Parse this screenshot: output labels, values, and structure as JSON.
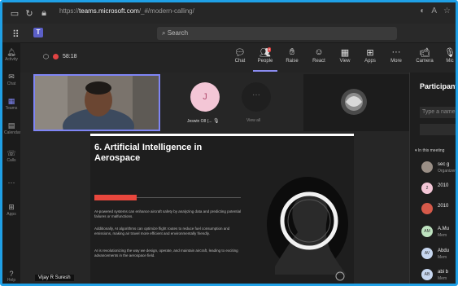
{
  "browser": {
    "url_prefix": "https://",
    "url_host": "teams.microsoft.com",
    "url_path": "/_#/modern-calling/"
  },
  "teams": {
    "search_placeholder": "Search"
  },
  "rail": [
    {
      "label": "Activity",
      "icon": "bell-icon"
    },
    {
      "label": "Chat",
      "icon": "chat-icon"
    },
    {
      "label": "Teams",
      "icon": "teams-icon"
    },
    {
      "label": "Calendar",
      "icon": "calendar-icon"
    },
    {
      "label": "Calls",
      "icon": "phone-icon"
    },
    {
      "label": "",
      "icon": "more-icon"
    },
    {
      "label": "Apps",
      "icon": "apps-icon"
    },
    {
      "label": "Help",
      "icon": "help-icon"
    }
  ],
  "meeting": {
    "timer": "58:18",
    "tools": [
      {
        "label": "Chat",
        "icon": "chat-icon"
      },
      {
        "label": "People",
        "icon": "people-icon"
      },
      {
        "label": "Raise",
        "icon": "hand-icon"
      },
      {
        "label": "React",
        "icon": "smile-icon"
      },
      {
        "label": "View",
        "icon": "grid-icon"
      },
      {
        "label": "Apps",
        "icon": "plus-box-icon"
      },
      {
        "label": "More",
        "icon": "more-icon"
      },
      {
        "label": "Camera",
        "icon": "camera-icon"
      },
      {
        "label": "Mic",
        "icon": "mic-icon"
      }
    ],
    "people_badge": "9"
  },
  "stage": {
    "jp_initial": "J",
    "jp_name": "Jeswin O8 (...",
    "view_all": "View all",
    "presenter": "Vijay R Suresh"
  },
  "slide": {
    "title": "6. Artificial Intelligence in Aerospace",
    "para1": "AI-powered systems can enhance aircraft safety by analyzing data and predicting potential failures or malfunctions.",
    "para2": "Additionally, AI algorithms can optimize flight routes to reduce fuel consumption and emissions, making air travel more efficient and environmentally friendly.",
    "para3": "AI is revolutionizing the way we design, operate, and maintain aircraft, leading to exciting advancements in the aerospace field."
  },
  "panel": {
    "title": "Participants",
    "invite_placeholder": "Type a name",
    "in_meeting": "In this meeting",
    "participants": [
      {
        "initials": "",
        "name": "sec g",
        "role": "Organizer",
        "color": "#9a8f86"
      },
      {
        "initials": "2",
        "name": "2010",
        "role": "",
        "color": "#f3c6d6"
      },
      {
        "initials": "",
        "name": "2010",
        "role": "",
        "color": "#d65a4a"
      },
      {
        "initials": "AM",
        "name": "A.Mu",
        "role": "Mem",
        "color": "#bfe3c0"
      },
      {
        "initials": "AV",
        "name": "Abdu",
        "role": "Mem",
        "color": "#c7d7f0"
      },
      {
        "initials": "AB",
        "name": "abi b",
        "role": "Mem",
        "color": "#c7d7f0"
      }
    ]
  }
}
